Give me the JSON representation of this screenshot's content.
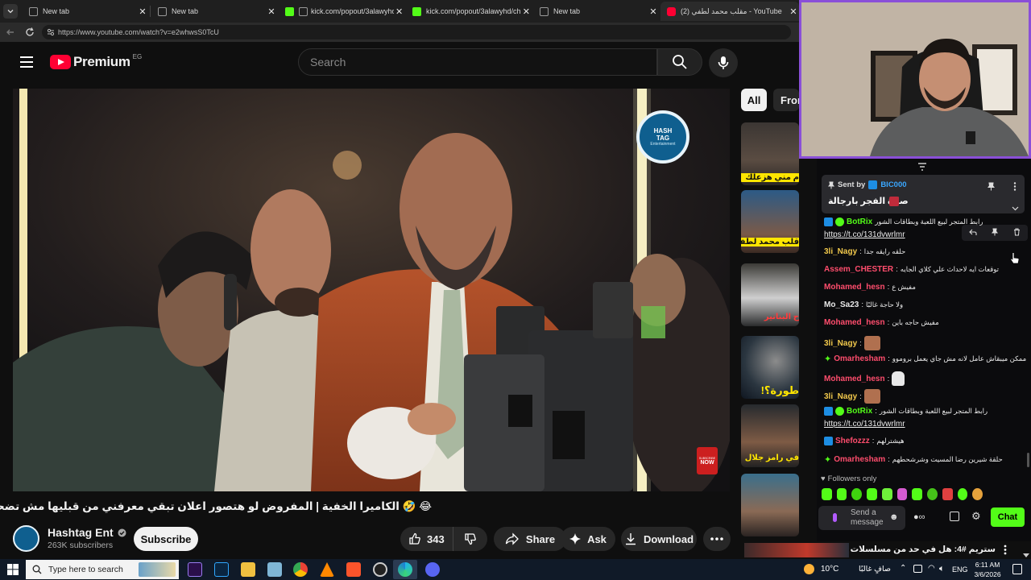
{
  "browser": {
    "tabs": [
      {
        "title": "New tab"
      },
      {
        "title": "New tab"
      },
      {
        "title": "kick.com/popout/3alawyhd/c"
      },
      {
        "title": "kick.com/popout/3alawyhd/chat"
      },
      {
        "title": "New tab"
      },
      {
        "title": "(2) مقلب محمد لطفي - YouTube"
      }
    ],
    "url": "https://www.youtube.com/watch?v=e2whwsS0TcU"
  },
  "youtube": {
    "logo_text": "Premium",
    "region": "EG",
    "search_placeholder": "Search",
    "chips": [
      "All",
      "From"
    ],
    "video": {
      "title": "😂 🤣 الكاميرا الخفية | المفروض لو هتصور اعلان تبقي معرفني من قبليها مش تضحك عليا",
      "overlay_logo_line1": "HASH",
      "overlay_logo_line2": "TAG",
      "overlay_logo_line3": "Entertainment",
      "subscribe_badge_line1": "SUBSCRIBE",
      "subscribe_badge_line2": "NOW"
    },
    "channel": {
      "name": "Hashtag Ent",
      "subscribers": "263K subscribers",
      "subscribe_label": "Subscribe"
    },
    "actions": {
      "likes": "343",
      "share": "Share",
      "ask": "Ask",
      "download": "Download"
    },
    "thumbnails": [
      {
        "caption": "م مني هزعلك"
      },
      {
        "caption": "قلب محمد لطفي"
      },
      {
        "caption": "ح البنانير"
      },
      {
        "caption": "طورة؟!"
      },
      {
        "caption": "في رامز جلال"
      },
      {
        "caption": ""
      }
    ],
    "ticker_text": "ستريم #4: هل في حد من مسلسلات النص"
  },
  "chat": {
    "pinned": {
      "sent_by_label": "Sent by",
      "sender": "BIC000",
      "text": "صلاة الفجر بارجالة"
    },
    "messages": [
      {
        "user": "BotRix",
        "color": "#53fc18",
        "text": "رابط المتجر لبيع اللعبة وبطاقات الشور",
        "link": "https://t.co/131dvwrlmr"
      },
      {
        "user": "3li_Nagy",
        "color": "#f2c94c",
        "text": "حلقه رايقه جدا"
      },
      {
        "user": "Assem_CHESTER",
        "color": "#ff4d6d",
        "text": "توقعات ايه لاحداث علي كلاي الجايه"
      },
      {
        "user": "Mohamed_hesn",
        "color": "#ff4d6d",
        "text": "مفيش ع"
      },
      {
        "user": "Mo_Sa23",
        "color": "#e8e8e8",
        "text": "ولا حاجة غالبًا"
      },
      {
        "user": "Mohamed_hesn",
        "color": "#ff4d6d",
        "text": "مفيش حاجه باين"
      },
      {
        "user": "3li_Nagy",
        "color": "#f2c94c",
        "text": ""
      },
      {
        "user": "Omarhesham",
        "color": "#ff4d6d",
        "text": "ممكن ميبقاش عامل لانه مش جاي يعمل بروموو"
      },
      {
        "user": "Mohamed_hesn",
        "color": "#ff4d6d",
        "text": ""
      },
      {
        "user": "3li_Nagy",
        "color": "#f2c94c",
        "text": ""
      },
      {
        "user": "BotRix",
        "color": "#53fc18",
        "text": "رابط المتجر لبيع اللعبة وبطاقات الشور",
        "link": "https://t.co/131dvwrlmr"
      },
      {
        "user": "Shefozzz",
        "color": "#ff4d6d",
        "text": "هيشترلهم"
      },
      {
        "user": "Omarhesham",
        "color": "#ff4d6d",
        "text": "حلقة شيرين رضا المسيت وشرشحطهم"
      }
    ],
    "followers_only": "Followers only",
    "send_placeholder": "Send a message",
    "chat_button": "Chat"
  },
  "taskbar": {
    "search_placeholder": "Type here to search",
    "weather_temp": "10°C",
    "weather_text": "صافٍ غالبًا",
    "language": "ENG",
    "time": "6:11 AM",
    "date": "3/6/2026"
  }
}
